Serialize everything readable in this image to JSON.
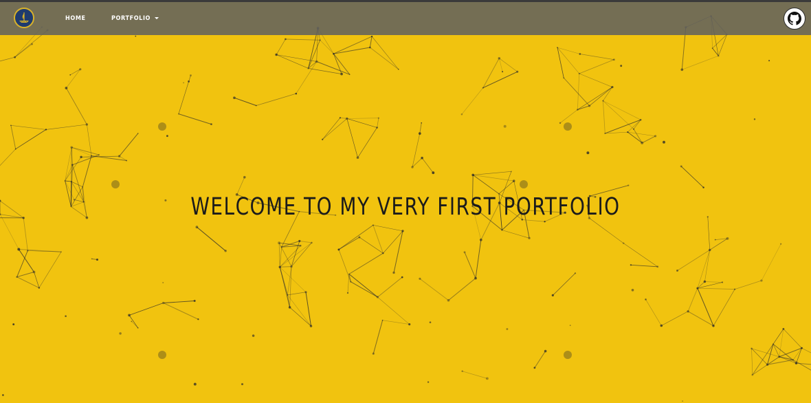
{
  "navbar": {
    "logo_icon": "ship-logo-icon",
    "home_label": "HOME",
    "portfolio_label": "PORTFOLIO",
    "portfolio_caret_icon": "caret-down-icon",
    "github_icon": "github-octocat-icon"
  },
  "hero": {
    "title": "WELCOME TO MY VERY FIRST PORTFOLIO",
    "background_color": "#f1c30f",
    "network_line_color": "#2a2a2a"
  }
}
